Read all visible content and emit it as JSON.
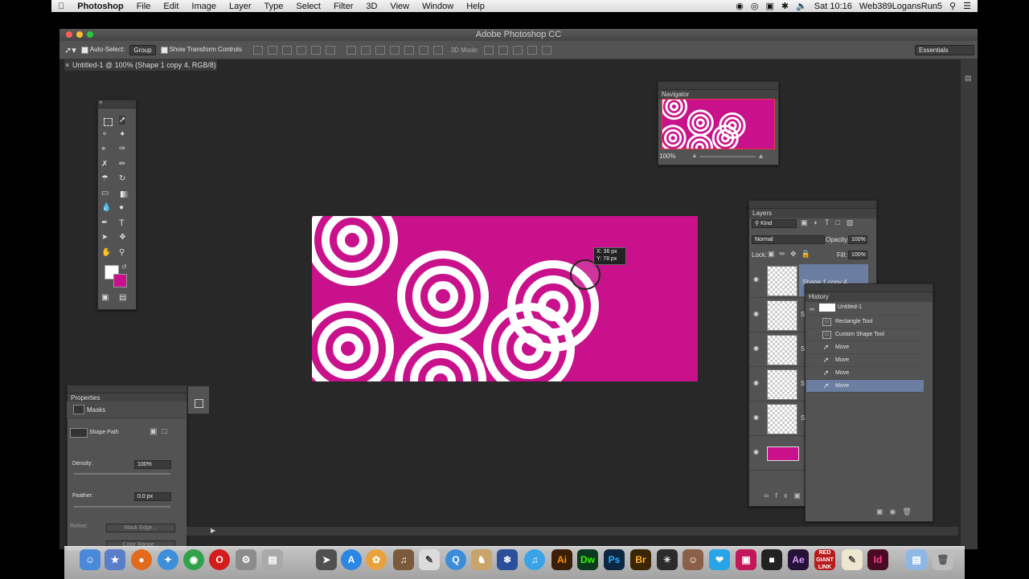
{
  "menubar": {
    "app": "Photoshop",
    "items": [
      "File",
      "Edit",
      "Image",
      "Layer",
      "Type",
      "Select",
      "Filter",
      "3D",
      "View",
      "Window",
      "Help"
    ],
    "clock": "Sat 10:16",
    "user": "Web389LogansRun5"
  },
  "window": {
    "title": "Adobe Photoshop CC"
  },
  "options_bar": {
    "auto_select_label": "Auto-Select:",
    "auto_select_value": "Group",
    "show_transform_label": "Show Transform Controls",
    "mode_3d_label": "3D Mode:",
    "workspace": "Essentials"
  },
  "document": {
    "tab": "Untitled-1 @ 100% (Shape 1 copy 4, RGB/8) *"
  },
  "canvas": {
    "background_color": "#c8118b",
    "ring_color": "#ffffff"
  },
  "readout": {
    "line1": "X: 36 px",
    "line2": "Y: 78 px"
  },
  "navigator": {
    "title": "Navigator",
    "zoom": "100%"
  },
  "layers": {
    "title": "Layers",
    "filter": "Kind",
    "blend_mode": "Normal",
    "opacity_label": "Opacity:",
    "opacity": "100%",
    "lock_label": "Lock:",
    "fill_label": "Fill:",
    "fill": "100%",
    "rows": [
      {
        "name": "Shape 1 copy 4",
        "selected": true
      },
      {
        "name": "S",
        "selected": false
      },
      {
        "name": "S",
        "selected": false
      },
      {
        "name": "S",
        "selected": false
      },
      {
        "name": "S",
        "selected": false
      },
      {
        "name": "",
        "selected": false
      }
    ]
  },
  "history": {
    "title": "History",
    "snapshot": "Untitled-1",
    "items": [
      "Rectangle Tool",
      "Custom Shape Tool",
      "Move",
      "Move",
      "Move",
      "Move"
    ]
  },
  "properties": {
    "title": "Properties",
    "section": "Masks",
    "shape_path": "Shape Path",
    "density_label": "Density:",
    "density": "100%",
    "feather_label": "Feather:",
    "feather": "0.0 px",
    "refine_label": "Refine:",
    "mask_edge": "Mask Edge...",
    "color_range": "Color Range..."
  },
  "dock": {
    "labels": [
      "Ai",
      "Dw",
      "Ps",
      "Br",
      "Ae",
      "Id"
    ],
    "colors": {
      "ai": "#3a1e07",
      "dw": "#0b3a1e",
      "ps": "#0b2741",
      "br": "#3a2604",
      "ae": "#251236",
      "id": "#4a0a24"
    }
  }
}
